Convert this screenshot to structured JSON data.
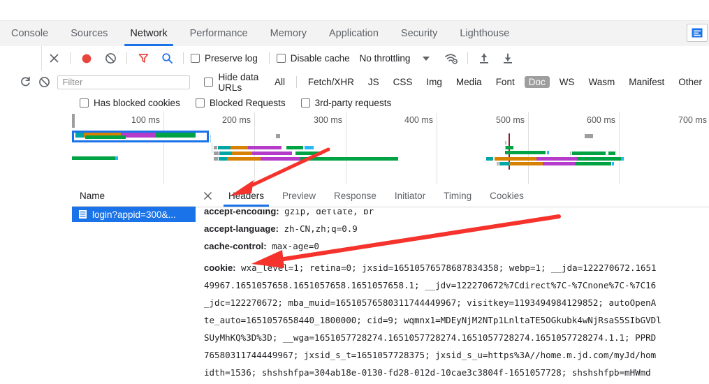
{
  "devtools": {
    "tabs": [
      {
        "label": "Console",
        "active": false
      },
      {
        "label": "Sources",
        "active": false
      },
      {
        "label": "Network",
        "active": true
      },
      {
        "label": "Performance",
        "active": false
      },
      {
        "label": "Memory",
        "active": false
      },
      {
        "label": "Application",
        "active": false
      },
      {
        "label": "Security",
        "active": false
      },
      {
        "label": "Lighthouse",
        "active": false
      }
    ],
    "drawer_button_icon": "console-drawer-icon"
  },
  "toolbar": {
    "close_icon": "close-icon",
    "record_icon": "record-button-icon",
    "clear_icon": "clear-icon",
    "filter_icon": "filter-funnel-icon",
    "search_icon": "search-icon",
    "preserve_log_label": "Preserve log",
    "preserve_log_checked": false,
    "disable_cache_label": "Disable cache",
    "disable_cache_checked": false,
    "throttling_value": "No throttling",
    "network_conditions_icon": "wifi-settings-icon",
    "import_icon": "import-har-icon",
    "export_icon": "export-har-icon"
  },
  "filters": {
    "reload_icon": "reload-icon",
    "clear_icon": "clear-icon",
    "search_placeholder": "Filter",
    "search_value": "",
    "hide_data_urls_label": "Hide data URLs",
    "hide_data_urls_checked": false,
    "types": [
      {
        "label": "All",
        "selected": false
      },
      {
        "label": "Fetch/XHR",
        "selected": false
      },
      {
        "label": "JS",
        "selected": false
      },
      {
        "label": "CSS",
        "selected": false
      },
      {
        "label": "Img",
        "selected": false
      },
      {
        "label": "Media",
        "selected": false
      },
      {
        "label": "Font",
        "selected": false
      },
      {
        "label": "Doc",
        "selected": true
      },
      {
        "label": "WS",
        "selected": false
      },
      {
        "label": "Wasm",
        "selected": false
      },
      {
        "label": "Manifest",
        "selected": false
      },
      {
        "label": "Other",
        "selected": false
      }
    ],
    "checkboxes": [
      {
        "label": "Has blocked cookies",
        "checked": false
      },
      {
        "label": "Blocked Requests",
        "checked": false
      },
      {
        "label": "3rd-party requests",
        "checked": false
      }
    ]
  },
  "overview": {
    "ticks": [
      "100 ms",
      "200 ms",
      "300 ms",
      "400 ms",
      "500 ms",
      "600 ms",
      "700 ms"
    ]
  },
  "request_list": {
    "column_header": "Name",
    "rows": [
      {
        "icon": "document-icon",
        "name": "login?appid=300&...",
        "selected": true
      }
    ]
  },
  "detail": {
    "close_icon": "close-icon",
    "tabs": [
      {
        "label": "Headers",
        "active": true
      },
      {
        "label": "Preview",
        "active": false
      },
      {
        "label": "Response",
        "active": false
      },
      {
        "label": "Initiator",
        "active": false
      },
      {
        "label": "Timing",
        "active": false
      },
      {
        "label": "Cookies",
        "active": false
      }
    ],
    "headers": [
      {
        "name": "accept-encoding:",
        "value": "gzip, deflate, br"
      },
      {
        "name": "accept-language:",
        "value": "zh-CN,zh;q=0.9"
      },
      {
        "name": "cache-control:",
        "value": "max-age=0"
      }
    ],
    "cookie_header_name": "cookie:",
    "cookie_lines": [
      "wxa_level=1; retina=0; jxsid=16510576578687834358; webp=1; __jda=122270672.1651",
      "49967.1651057658.1651057658.1651057658.1; __jdv=122270672%7Cdirect%7C-%7Cnone%7C-%7C16",
      "_jdc=122270672; mba_muid=16510576580311744449967; visitkey=1193494984129852; autoOpenA",
      "te_auto=1651057658440_1800000; cid=9; wqmnx1=MDEyNjM2NTp1LnltaTE5OGkubk4wNjRsaS5SIbGVDl",
      "SUyMhKQ%3D%3D; __wga=1651057728274.1651057728274.1651057728274.1651057728274.1.1; PPRD",
      "76580311744449967; jxsid_s_t=1651057728375; jxsid_s_u=https%3A//home.m.jd.com/myJd/hom",
      "idth=1536; shshshfpa=304ab18e-0130-fd28-012d-10cae3c3804f-1651057728; shshshfpb=mHWmd"
    ]
  },
  "colors": {
    "accent": "#1a73e8",
    "record": "#e8453c",
    "filter": "#e8453c",
    "search": "#1a73e8",
    "selected_type_bg": "#9e9e9e",
    "annotation_arrow": "#f5322b"
  }
}
